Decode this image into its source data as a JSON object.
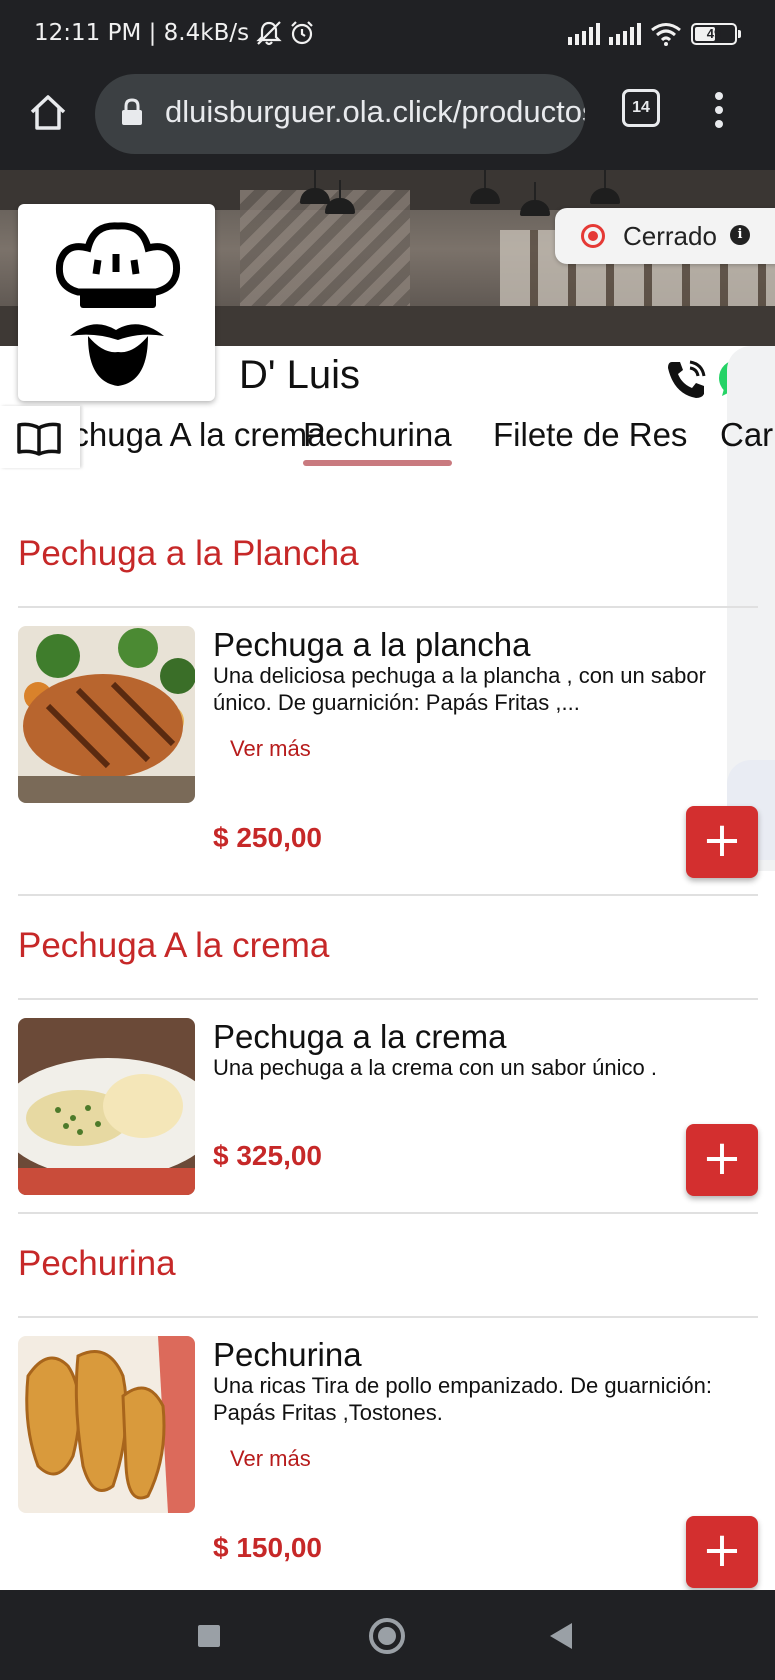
{
  "status_bar": {
    "time_speed": "12:11 PM | 8.4kB/s",
    "battery": "49",
    "battery_level": 0.49
  },
  "browser": {
    "url": "dluisburguer.ola.click/productos",
    "tab_count": "14"
  },
  "store": {
    "name": "D' Luis",
    "status": "Cerrado"
  },
  "categories": [
    "Pechuga A la crema",
    "Pechurina",
    "Filete de Res",
    "Carnes"
  ],
  "active_category": "Pechurina",
  "sections": [
    {
      "title": "Pechuga a la Plancha",
      "product": {
        "name": "Pechuga a la plancha",
        "description": "Una deliciosa pechuga a la plancha , con un sabor único. De guarnición: Papás Fritas ,...",
        "more": "Ver más",
        "price": "$ 250,00"
      }
    },
    {
      "title": "Pechuga A la crema",
      "product": {
        "name": "Pechuga a la crema",
        "description": "Una pechuga a la crema con un sabor único .",
        "price": "$ 325,00"
      }
    },
    {
      "title": "Pechurina",
      "product": {
        "name": "Pechurina",
        "description": "Una ricas Tira de pollo empanizado. De guarnición: Papás Fritas ,Tostones.",
        "more": "Ver más",
        "price": "$ 150,00"
      }
    }
  ],
  "add_label": "+",
  "colors": {
    "accent": "#c62828",
    "button": "#d32f2f",
    "status_dot": "#e53935",
    "chrome": "#202124"
  }
}
